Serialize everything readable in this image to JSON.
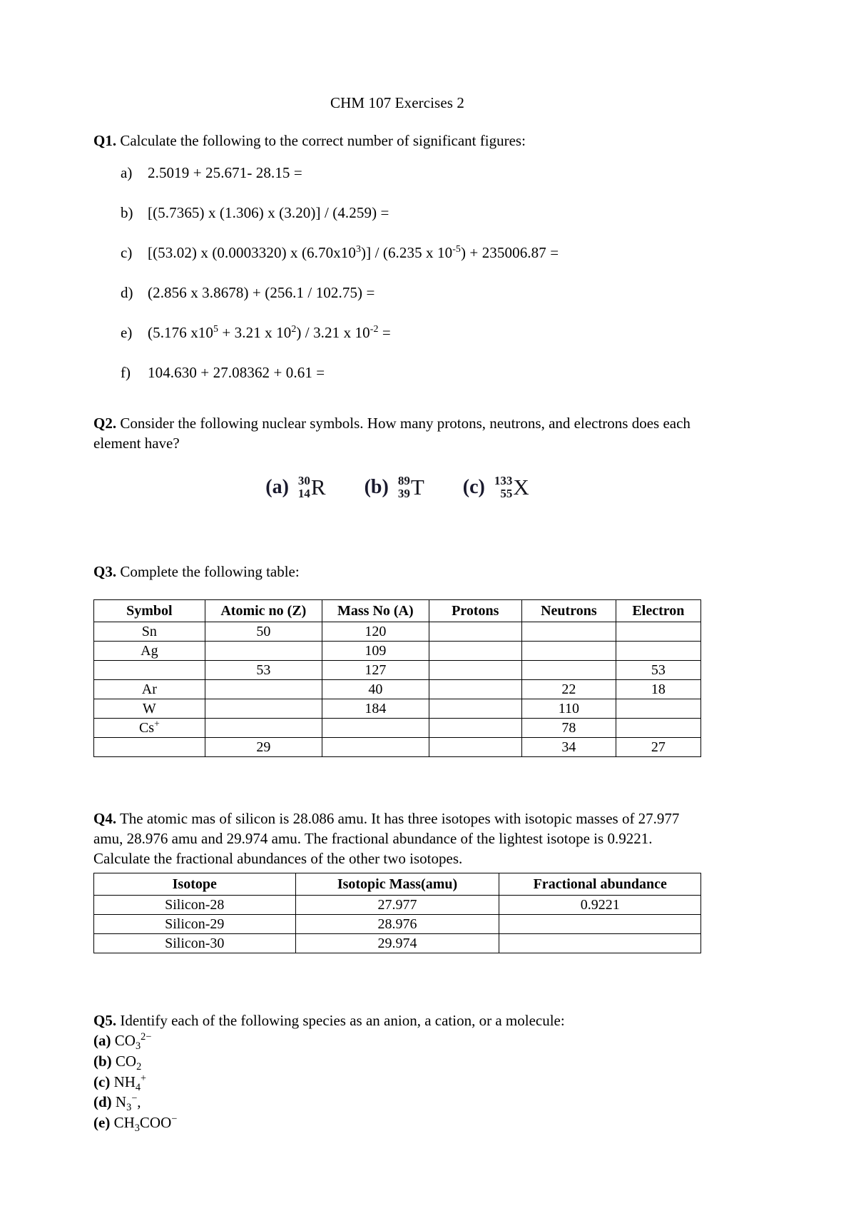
{
  "document": {
    "title": "CHM 107 Exercises 2"
  },
  "q1": {
    "label": "Q1.",
    "prompt": "Calculate the following to the correct number of significant figures:",
    "items": [
      {
        "marker": "a)",
        "text": "2.5019 + 25.671- 28.15 ="
      },
      {
        "marker": "b)",
        "text": "[(5.7365) x (1.306) x (3.20)] / (4.259) ="
      },
      {
        "marker": "c)",
        "text": "[(53.02) x (0.0003320) x (6.70x10³)] / (6.235 x 10⁻⁵) + 235006.87 ="
      },
      {
        "marker": "d)",
        "text": "(2.856 x 3.8678) + (256.1 / 102.75) ="
      },
      {
        "marker": "e)",
        "text": "(5.176 x10⁵ + 3.21 x 10²) / 3.21 x 10⁻² ="
      },
      {
        "marker": "f)",
        "text": "104.630 + 27.08362 + 0.61 ="
      }
    ]
  },
  "q2": {
    "label": "Q2.",
    "prompt": "Consider the following nuclear symbols. How many protons, neutrons, and electrons does each element have?",
    "symbols": [
      {
        "marker": "(a)",
        "mass_number": "30",
        "atomic_number": "14",
        "element": "R"
      },
      {
        "marker": "(b)",
        "mass_number": "89",
        "atomic_number": "39",
        "element": "T"
      },
      {
        "marker": "(c)",
        "mass_number": "133",
        "atomic_number": "55",
        "element": "X"
      }
    ]
  },
  "q3": {
    "label": "Q3.",
    "prompt": "Complete the following table:",
    "table": {
      "headers": [
        "Symbol",
        "Atomic no (Z)",
        "Mass No (A)",
        "Protons",
        "Neutrons",
        "Electron"
      ],
      "rows": [
        {
          "symbol": "Sn",
          "z": "50",
          "a": "120",
          "protons": "",
          "neutrons": "",
          "electrons": ""
        },
        {
          "symbol": "Ag",
          "z": "",
          "a": "109",
          "protons": "",
          "neutrons": "",
          "electrons": ""
        },
        {
          "symbol": "",
          "z": "53",
          "a": "127",
          "protons": "",
          "neutrons": "",
          "electrons": "53"
        },
        {
          "symbol": "Ar",
          "z": "",
          "a": "40",
          "protons": "",
          "neutrons": "22",
          "electrons": "18"
        },
        {
          "symbol": "W",
          "z": "",
          "a": "184",
          "protons": "",
          "neutrons": "110",
          "electrons": ""
        },
        {
          "symbol": "Cs+",
          "z": "",
          "a": "",
          "protons": "",
          "neutrons": "78",
          "electrons": ""
        },
        {
          "symbol": "",
          "z": "29",
          "a": "",
          "protons": "",
          "neutrons": "34",
          "electrons": "27"
        }
      ]
    }
  },
  "q4": {
    "label": "Q4.",
    "prompt_line1": "The atomic mas of silicon is 28.086 amu. It has three isotopes with isotopic masses of 27.977",
    "prompt_line2": "amu, 28.976 amu and 29.974 amu. The fractional abundance of the lightest isotope is 0.9221.",
    "prompt_line3": "Calculate the fractional abundances of the other two isotopes.",
    "table": {
      "headers": [
        "Isotope",
        "Isotopic Mass(amu)",
        "Fractional abundance"
      ],
      "rows": [
        {
          "isotope": "Silicon-28",
          "mass": "27.977",
          "abundance": "0.9221"
        },
        {
          "isotope": "Silicon-29",
          "mass": "28.976",
          "abundance": ""
        },
        {
          "isotope": "Silicon-30",
          "mass": "29.974",
          "abundance": ""
        }
      ]
    }
  },
  "q5": {
    "label": "Q5.",
    "prompt": "Identify each of the following species as an anion, a cation, or a molecule:",
    "items": [
      {
        "marker": "(a)",
        "formula": "CO₃²⁻"
      },
      {
        "marker": "(b)",
        "formula": "CO₂"
      },
      {
        "marker": "(c)",
        "formula": "NH₄⁺"
      },
      {
        "marker": "(d)",
        "formula": "N₃⁻,"
      },
      {
        "marker": "(e)",
        "formula": "CH₃COO⁻"
      }
    ]
  }
}
